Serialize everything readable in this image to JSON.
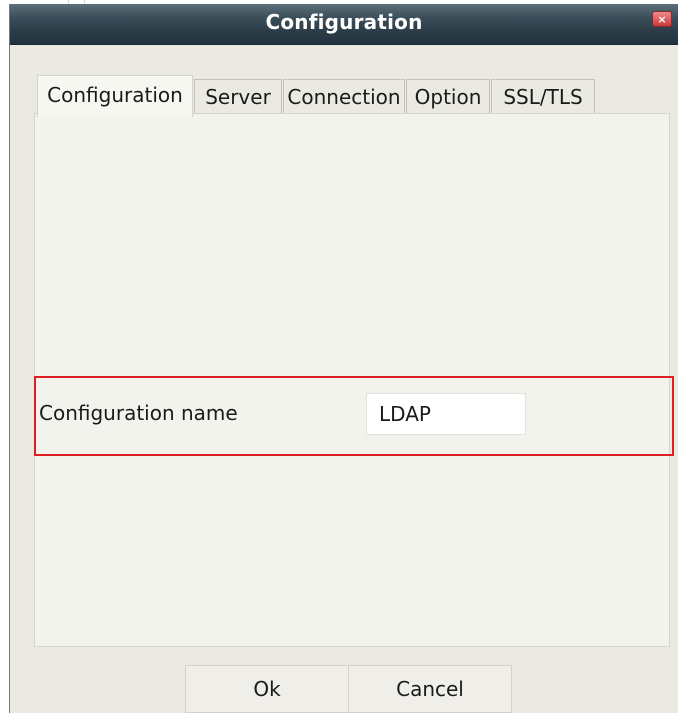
{
  "window": {
    "title": "Configuration",
    "close_glyph": "×"
  },
  "tabs": [
    {
      "label": "Configuration",
      "active": true
    },
    {
      "label": "Server",
      "active": false
    },
    {
      "label": "Connection",
      "active": false
    },
    {
      "label": "Option",
      "active": false
    },
    {
      "label": "SSL/TLS",
      "active": false
    }
  ],
  "form": {
    "config_name_label": "Configuration name",
    "config_name_value": "LDAP"
  },
  "buttons": {
    "ok_label": "Ok",
    "cancel_label": "Cancel"
  },
  "colors": {
    "highlight": "#e02020",
    "titlebar": "#2b3c47",
    "window_bg": "#ebeae2"
  }
}
